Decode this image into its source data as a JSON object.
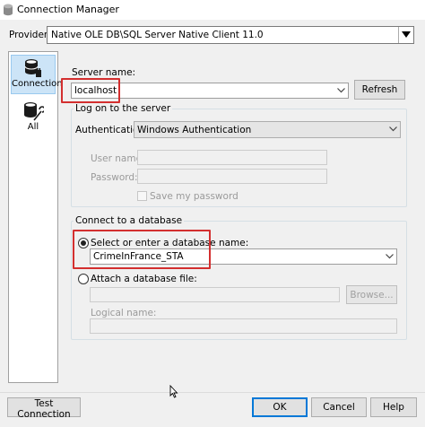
{
  "window": {
    "title": "Connection Manager"
  },
  "provider": {
    "label": "Provider:",
    "value": "Native OLE DB\\SQL Server Native Client 11.0"
  },
  "sidebar": {
    "items": [
      {
        "label": "Connection"
      },
      {
        "label": "All"
      }
    ]
  },
  "server": {
    "label": "Server name:",
    "value": "localhost",
    "refresh_label": "Refresh"
  },
  "logon": {
    "group_title": "Log on to the server",
    "auth_label": "Authentication:",
    "auth_value": "Windows Authentication",
    "username_label": "User name:",
    "password_label": "Password:",
    "save_password_label": "Save my password"
  },
  "database": {
    "group_title": "Connect to a database",
    "select_option_label": "Select or enter a database name:",
    "db_name_value": "CrimeInFrance_STA",
    "attach_option_label": "Attach a database file:",
    "browse_label": "Browse...",
    "logical_name_label": "Logical name:"
  },
  "footer": {
    "test_connection_label": "Test Connection",
    "ok_label": "OK",
    "cancel_label": "Cancel",
    "help_label": "Help"
  },
  "colors": {
    "highlight": "#d32f2f",
    "default_button_border": "#0078d7",
    "selected_nav": "#cce4f7"
  }
}
